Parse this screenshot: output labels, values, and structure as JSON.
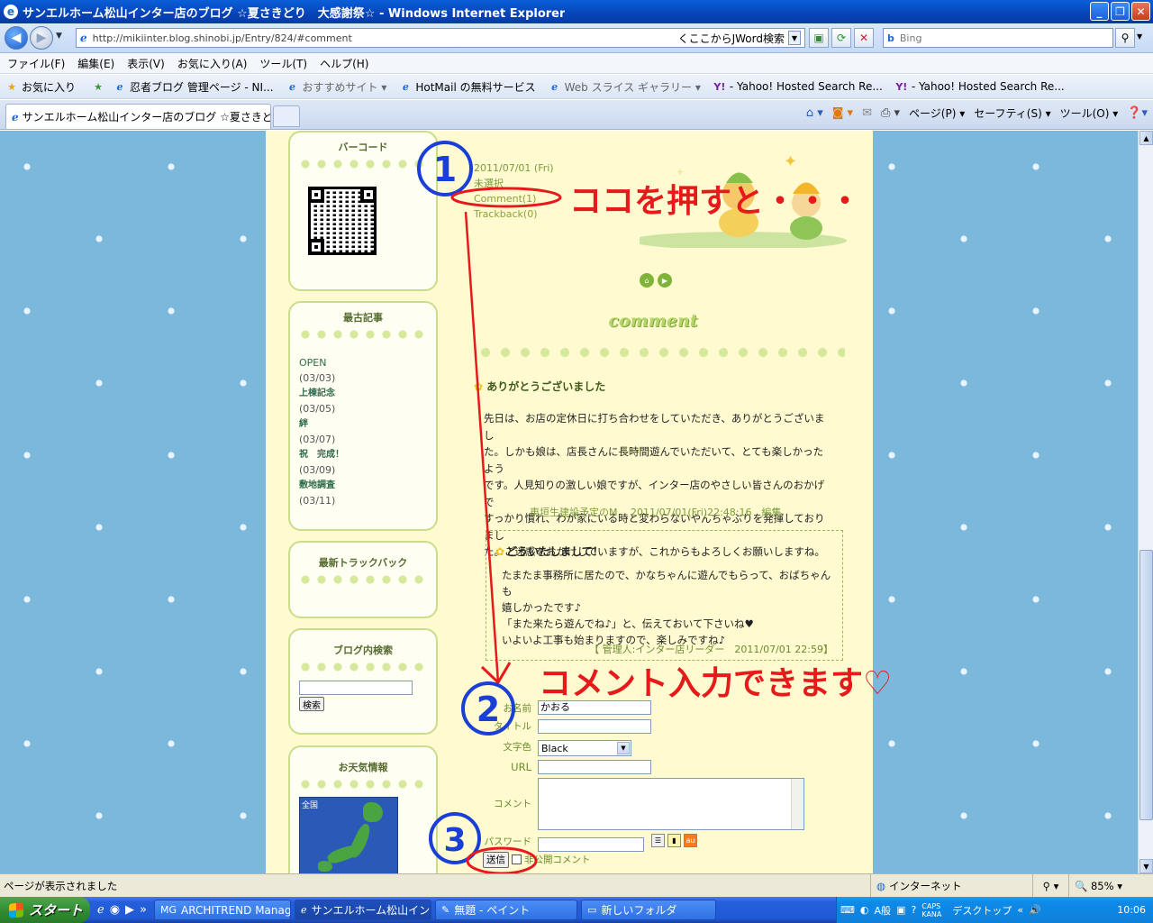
{
  "window": {
    "title": "サンエルホーム松山インター店のブログ ☆夏さきどり　大感謝祭☆ - Windows Internet Explorer",
    "buttons": {
      "minimize": "_",
      "maximize": "❐",
      "close": "✕"
    }
  },
  "address": {
    "url": "http://mikiinter.blog.shinobi.jp/Entry/824/#comment",
    "jword": "くここからJWord検索",
    "search_placeholder": "Bing"
  },
  "menu": [
    "ファイル(F)",
    "編集(E)",
    "表示(V)",
    "お気に入り(A)",
    "ツール(T)",
    "ヘルプ(H)"
  ],
  "favorites": {
    "main": "お気に入り",
    "items": [
      {
        "label": "忍者ブログ 管理ページ - NI...",
        "icon": "ie-page-icon",
        "gray": false
      },
      {
        "label": "おすすめサイト ▾",
        "icon": "ie-page-icon",
        "gray": true
      },
      {
        "label": "HotMail の無料サービス",
        "icon": "ie-page-icon",
        "gray": false
      },
      {
        "label": "Web スライス ギャラリー ▾",
        "icon": "ie-page-icon",
        "gray": true
      },
      {
        "label": "- Yahoo! Hosted Search Re...",
        "icon": "yahoo-icon",
        "gray": false
      },
      {
        "label": "- Yahoo! Hosted Search Re...",
        "icon": "yahoo-icon",
        "gray": false
      }
    ]
  },
  "tab": {
    "active_title": "サンエルホーム松山インター店のブログ ☆夏さきどり　大..."
  },
  "commandbar": {
    "page": "ページ(P) ▾",
    "safety": "セーフティ(S) ▾",
    "tools": "ツール(O) ▾"
  },
  "sidebar": {
    "barcode": {
      "heading": "バーコード"
    },
    "oldest": {
      "heading": "最古記事",
      "items": [
        {
          "title": "OPEN",
          "date": "(03/03)"
        },
        {
          "title": "上棟記念",
          "date": "(03/05)"
        },
        {
          "title": "絆",
          "date": "(03/07)"
        },
        {
          "title": "祝　完成！",
          "date": "(03/09)"
        },
        {
          "title": "敷地調査",
          "date": "(03/11)"
        }
      ]
    },
    "trackback": {
      "heading": "最新トラックバック"
    },
    "search": {
      "heading": "ブログ内検索",
      "button": "検索"
    },
    "weather": {
      "heading": "お天気情報",
      "map_label": "全国"
    }
  },
  "post": {
    "date": "2011/07/01 (Fri)",
    "category": "未選択",
    "comment_link": "Comment(1)",
    "trackback_link": "Trackback(0)"
  },
  "comments": {
    "heading": "comment",
    "first": {
      "title": "ありがとうございました",
      "body_lines": [
        "先日は、お店の定休日に打ち合わせをしていただき、ありがとうございまし",
        "た。しかも娘は、店長さんに長時間遊んでいただいて、とても楽しかったよう",
        "です。人見知りの激しい娘ですが、インター店のやさしい皆さんのおかげで",
        "すっかり慣れ、わが家にいる時と変わらないやんちゃぶりを発揮しておりまし",
        "た。ご迷惑をおかけしていますが、これからもよろしくお願いしますね。"
      ],
      "meta": "東垣生建設予定のM　 2011/07/01(Fri)22:48:16　編集"
    },
    "reply": {
      "title": "どういたしまして！",
      "body_lines": [
        "たまたま事務所に居たので、かなちゃんに遊んでもらって、おばちゃんも",
        "嬉しかったです♪",
        "「また来たら遊んでね♪」と、伝えておいて下さいね♥",
        "いよいよ工事も始まりますので、楽しみですね♪"
      ],
      "meta": "【 管理人:インター店リーダー　2011/07/01 22:59】"
    }
  },
  "form": {
    "name_label": "お名前",
    "name_value": "かおる",
    "title_label": "タイトル",
    "color_label": "文字色",
    "color_value": "Black",
    "url_label": "URL",
    "comment_label": "コメント",
    "password_label": "パスワード",
    "send_button": "送信",
    "private_label": "非公開コメント"
  },
  "annotations": {
    "step1": "1",
    "step2": "2",
    "step3": "3",
    "text1": "ココを押すと・・・",
    "text2": "コメント入力できます♡",
    "color": "#e61a1a",
    "number_color": "#1a3fd6"
  },
  "statusbar": {
    "message": "ページが表示されました",
    "zone": "インターネット",
    "zoom": "85%"
  },
  "taskbar": {
    "start": "スタート",
    "tasks": [
      {
        "label": "ARCHITREND Manage...",
        "icon": "MG"
      },
      {
        "label": "サンエルホーム松山イン...",
        "icon": "ℯ"
      },
      {
        "label": "無題 - ペイント",
        "icon": "✎"
      },
      {
        "label": "新しいフォルダ",
        "icon": "▭"
      }
    ],
    "tray_ime": "A般",
    "tray_desktop": "デスクトップ",
    "clock": "10:06"
  }
}
